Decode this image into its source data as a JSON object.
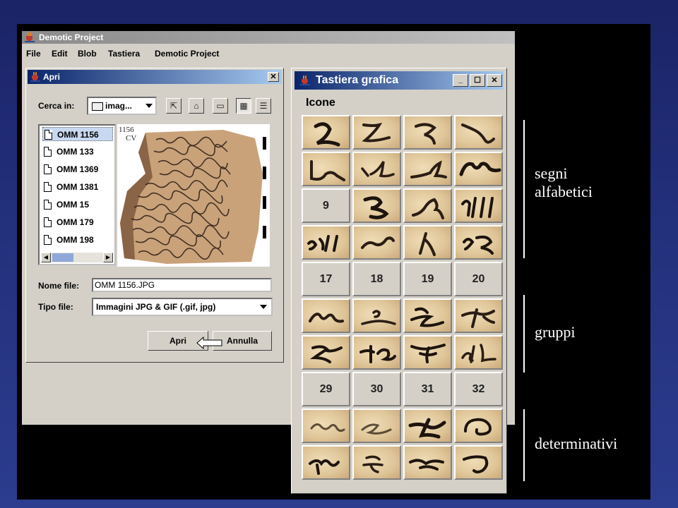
{
  "app": {
    "title": "Demotic Project",
    "menu": [
      {
        "label": "File"
      },
      {
        "label": "Edit"
      },
      {
        "label": "Blob"
      },
      {
        "label": "Tastiera"
      },
      {
        "label": "Demotic Project"
      }
    ]
  },
  "open_dialog": {
    "title": "Apri",
    "look_in_label": "Cerca in:",
    "look_in_value": "imag...",
    "toolbar_icons": [
      "up-folder-icon",
      "home-icon",
      "new-folder-icon",
      "list-view-icon",
      "details-view-icon"
    ],
    "files": [
      "OMM 1156",
      "OMM 133",
      "OMM 1369",
      "OMM 1381",
      "OMM 15",
      "OMM 179",
      "OMM 198"
    ],
    "selected_file": "OMM 1156",
    "preview_caption_line1": "1156",
    "preview_caption_line2": "CV",
    "filename_label": "Nome file:",
    "filename_value": "OMM 1156.JPG",
    "filetype_label": "Tipo file:",
    "filetype_value": "Immagini JPG & GIF (.gif, jpg)",
    "open_button": "Apri",
    "cancel_button": "Annulla"
  },
  "keyboard": {
    "title": "Tastiera grafica",
    "menu_label": "Icone",
    "numbered_cells": {
      "r3c1": "9",
      "r5c1": "17",
      "r5c2": "18",
      "r5c3": "19",
      "r5c4": "20",
      "r8c1": "29",
      "r8c2": "30",
      "r8c3": "31",
      "r8c4": "32"
    }
  },
  "annotations": {
    "alphabetic": "segni\nalfabetici",
    "alphabetic_line1": "segni",
    "alphabetic_line2": "alfabetici",
    "groups": "gruppi",
    "determinatives": "determinativi"
  }
}
